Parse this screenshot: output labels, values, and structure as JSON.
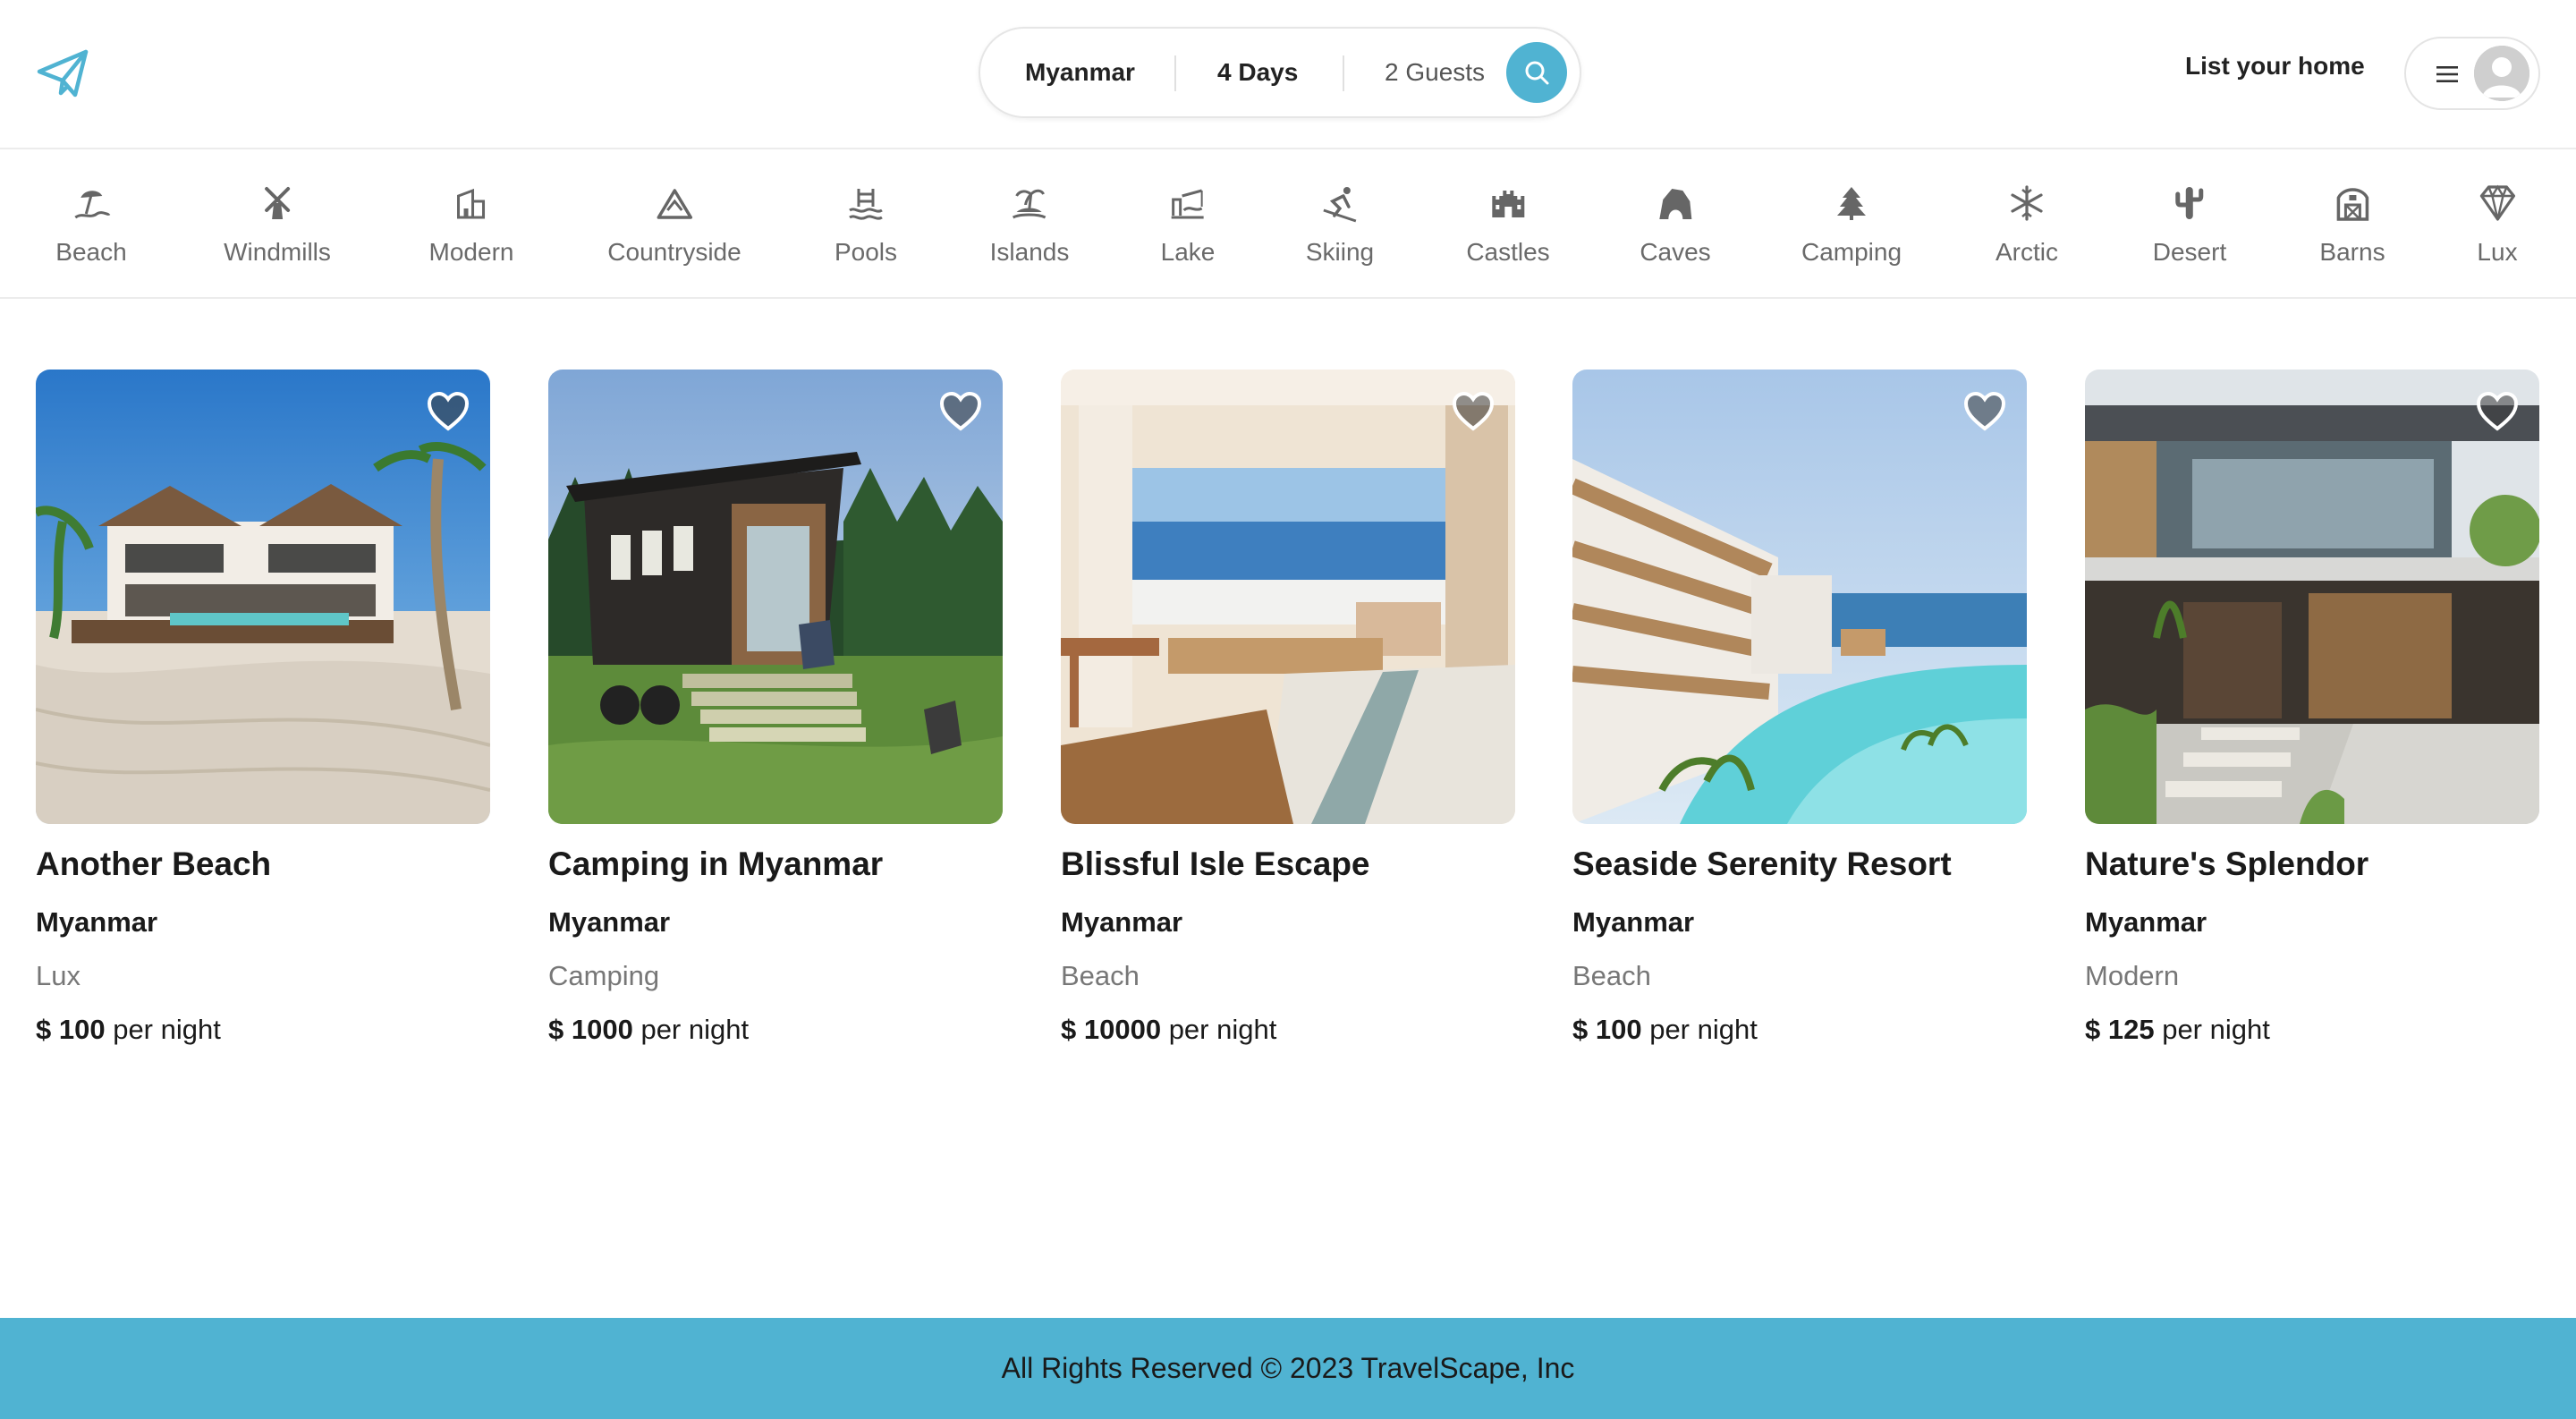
{
  "app": {
    "brand": "TravelScape",
    "logo_icon": "paper-plane-icon",
    "accent": "#50b3d2"
  },
  "search": {
    "location": "Myanmar",
    "duration": "4 Days",
    "guests": "2 Guests",
    "button_icon": "search-icon"
  },
  "header": {
    "list_home": "List your home",
    "menu_icon": "hamburger-menu-icon",
    "avatar_icon": "avatar-placeholder-icon"
  },
  "categories": [
    {
      "label": "Beach",
      "icon": "beach-umbrella-icon"
    },
    {
      "label": "Windmills",
      "icon": "windmill-icon"
    },
    {
      "label": "Modern",
      "icon": "modern-building-icon"
    },
    {
      "label": "Countryside",
      "icon": "mountain-icon"
    },
    {
      "label": "Pools",
      "icon": "pool-icon"
    },
    {
      "label": "Islands",
      "icon": "island-icon"
    },
    {
      "label": "Lake",
      "icon": "lake-icon"
    },
    {
      "label": "Skiing",
      "icon": "skier-icon"
    },
    {
      "label": "Castles",
      "icon": "castle-icon"
    },
    {
      "label": "Caves",
      "icon": "cave-icon"
    },
    {
      "label": "Camping",
      "icon": "camping-tree-icon"
    },
    {
      "label": "Arctic",
      "icon": "snowflake-icon"
    },
    {
      "label": "Desert",
      "icon": "cactus-icon"
    },
    {
      "label": "Barns",
      "icon": "barn-icon"
    },
    {
      "label": "Lux",
      "icon": "diamond-icon"
    }
  ],
  "listings": [
    {
      "title": "Another Beach",
      "location": "Myanmar",
      "category": "Lux",
      "price": "$ 100",
      "price_suffix": "per night"
    },
    {
      "title": "Camping in Myanmar",
      "location": "Myanmar",
      "category": "Camping",
      "price": "$ 1000",
      "price_suffix": "per night"
    },
    {
      "title": "Blissful Isle Escape",
      "location": "Myanmar",
      "category": "Beach",
      "price": "$ 10000",
      "price_suffix": "per night"
    },
    {
      "title": "Seaside Serenity Resort",
      "location": "Myanmar",
      "category": "Beach",
      "price": "$ 100",
      "price_suffix": "per night"
    },
    {
      "title": "Nature's Splendor",
      "location": "Myanmar",
      "category": "Modern",
      "price": "$ 125",
      "price_suffix": "per night"
    }
  ],
  "footer": {
    "text": "All Rights Reserved © 2023 TravelScape, Inc"
  }
}
